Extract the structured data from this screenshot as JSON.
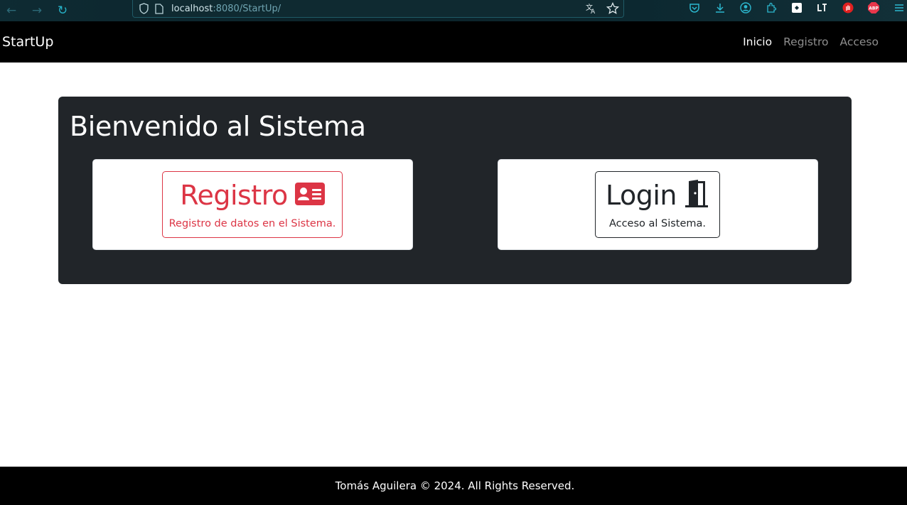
{
  "browser": {
    "url_host": "localhost",
    "url_path": ":8080/StartUp/"
  },
  "navbar": {
    "brand": "StartUp",
    "links": [
      {
        "label": "Inicio",
        "active": true
      },
      {
        "label": "Registro",
        "active": false
      },
      {
        "label": "Acceso",
        "active": false
      }
    ]
  },
  "hero": {
    "title": "Bienvenido al Sistema",
    "cards": [
      {
        "title": "Registro",
        "subtitle": "Registro de datos en el Sistema.",
        "icon": "id-card-icon",
        "color": "#dc3545"
      },
      {
        "title": "Login",
        "subtitle": "Acceso al Sistema.",
        "icon": "door-icon",
        "color": "#212529"
      }
    ]
  },
  "footer": {
    "text": "Tomás Aguilera © 2024. All Rights Reserved."
  },
  "extension_badge": "ABP",
  "colors": {
    "navbar_bg": "#000000",
    "hero_bg": "#212529",
    "danger": "#dc3545",
    "browser_accent": "#27b3c9"
  }
}
